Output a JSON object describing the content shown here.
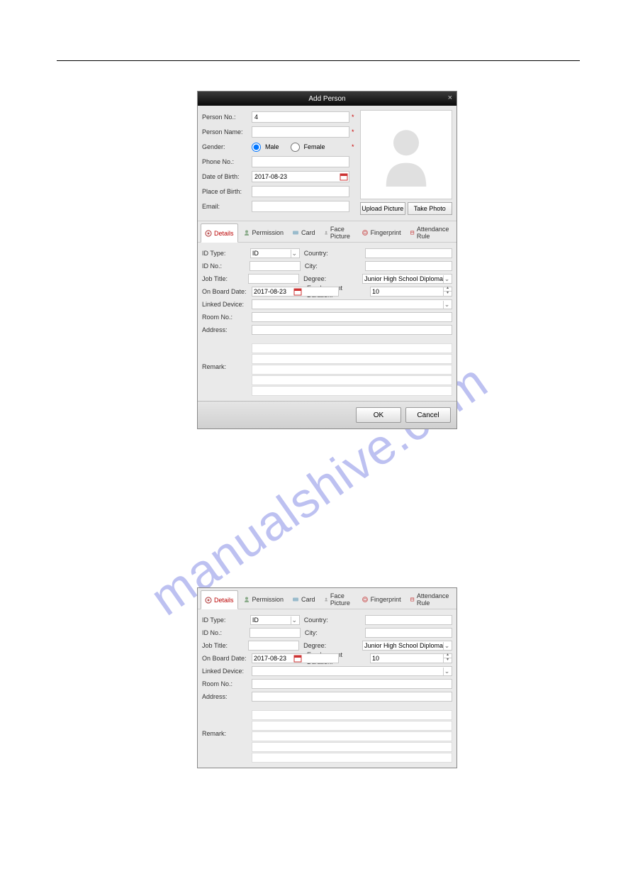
{
  "watermark": "manualshive.com",
  "dialog": {
    "title": "Add Person",
    "close": "×",
    "person": {
      "person_no_label": "Person No.:",
      "person_no_value": "4",
      "person_name_label": "Person Name:",
      "gender_label": "Gender:",
      "gender_male": "Male",
      "gender_female": "Female",
      "phone_label": "Phone No.:",
      "dob_label": "Date of Birth:",
      "dob_value": "2017-08-23",
      "pob_label": "Place of Birth:",
      "email_label": "Email:",
      "required": "*"
    },
    "photo": {
      "upload": "Upload Picture",
      "take": "Take Photo"
    },
    "tabs": {
      "details": "Details",
      "permission": "Permission",
      "card": "Card",
      "face": "Face Picture",
      "fingerprint": "Fingerprint",
      "attendance": "Attendance Rule"
    },
    "details": {
      "id_type_label": "ID Type:",
      "id_type_value": "ID",
      "country_label": "Country:",
      "id_no_label": "ID No.:",
      "city_label": "City:",
      "job_title_label": "Job Title:",
      "degree_label": "Degree:",
      "degree_value": "Junior High School Diploma",
      "on_board_label": "On Board Date:",
      "on_board_value": "2017-08-23",
      "emp_dur_label": "Employment Duration:",
      "emp_dur_value": "10",
      "linked_dev_label": "Linked Device:",
      "room_label": "Room No.:",
      "address_label": "Address:",
      "remark_label": "Remark:"
    },
    "buttons": {
      "ok": "OK",
      "cancel": "Cancel"
    }
  }
}
